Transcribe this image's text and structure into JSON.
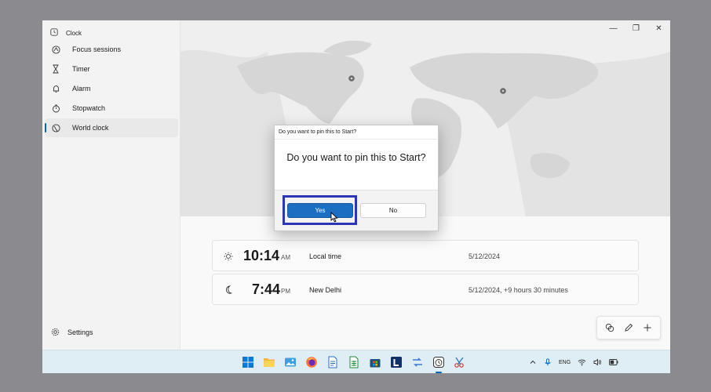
{
  "app": {
    "title": "Clock"
  },
  "sidebar": {
    "items": [
      {
        "label": "Focus sessions",
        "icon": "focus-icon"
      },
      {
        "label": "Timer",
        "icon": "hourglass-icon"
      },
      {
        "label": "Alarm",
        "icon": "bell-icon"
      },
      {
        "label": "Stopwatch",
        "icon": "stopwatch-icon"
      },
      {
        "label": "World clock",
        "icon": "globe-icon",
        "selected": true
      }
    ],
    "settings_label": "Settings"
  },
  "window_controls": {
    "minimize": "—",
    "restore": "❐",
    "close": "✕"
  },
  "world_clock": {
    "rows": [
      {
        "time": "10:14",
        "ampm": "AM",
        "label": "Local time",
        "date": "5/12/2024",
        "icon": "sun-icon"
      },
      {
        "time": "7:44",
        "ampm": "PM",
        "label": "New Delhi",
        "date": "5/12/2024, +9 hours 30 minutes",
        "icon": "moon-icon"
      }
    ]
  },
  "dialog": {
    "titlebar": "Do you want to pin this to Start?",
    "message": "Do you want to pin this to Start?",
    "yes_label": "Yes",
    "no_label": "No"
  },
  "taskbar": {
    "apps": [
      "windows-start-icon",
      "file-explorer-icon",
      "photos-icon",
      "firefox-icon",
      "document-icon",
      "spreadsheet-icon",
      "store-icon",
      "l-app-icon",
      "app-icon",
      "clock-app-icon",
      "snipping-tool-icon"
    ],
    "language": "ENG"
  },
  "colors": {
    "accent": "#0067c0",
    "dialog_primary": "#1b6ec2",
    "highlight_box": "#2b36b5",
    "taskbar": "#dfeef4"
  }
}
